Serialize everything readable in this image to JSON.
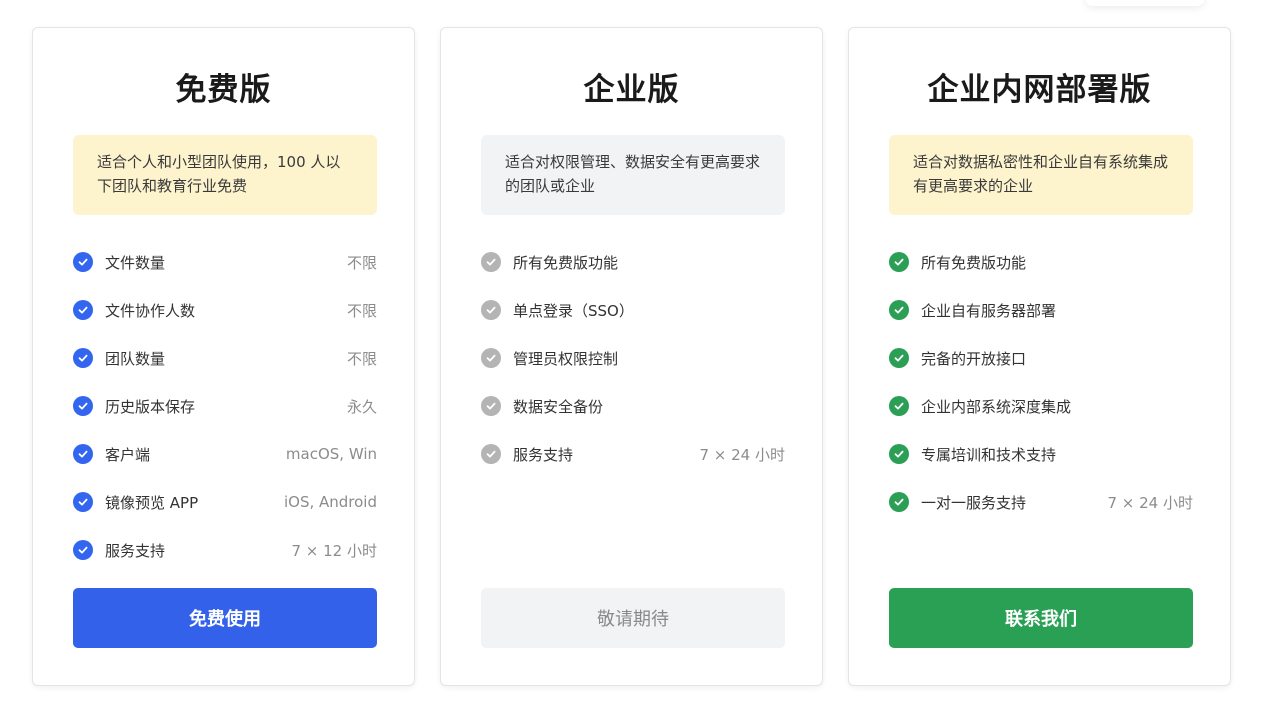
{
  "colors": {
    "blue_accent": "#3361ea",
    "green_accent": "#2aa055",
    "gray_check": "#b4b4b4",
    "yellow_box": "#fdf3cd",
    "gray_box": "#f2f3f5"
  },
  "plans": [
    {
      "title": "免费版",
      "description": "适合个人和小型团队使用，100 人以下团队和教育行业免费",
      "features": [
        {
          "label": "文件数量",
          "value": "不限"
        },
        {
          "label": "文件协作人数",
          "value": "不限"
        },
        {
          "label": "团队数量",
          "value": "不限"
        },
        {
          "label": "历史版本保存",
          "value": "永久"
        },
        {
          "label": "客户端",
          "value": "macOS, Win"
        },
        {
          "label": "镜像预览 APP",
          "value": "iOS, Android"
        },
        {
          "label": "服务支持",
          "value": "7 × 12 小时"
        }
      ],
      "button": "免费使用"
    },
    {
      "title": "企业版",
      "description": "适合对权限管理、数据安全有更高要求的团队或企业",
      "features": [
        {
          "label": "所有免费版功能",
          "value": ""
        },
        {
          "label": "单点登录（SSO）",
          "value": ""
        },
        {
          "label": "管理员权限控制",
          "value": ""
        },
        {
          "label": "数据安全备份",
          "value": ""
        },
        {
          "label": "服务支持",
          "value": "7 × 24 小时"
        }
      ],
      "button": "敬请期待"
    },
    {
      "title": "企业内网部署版",
      "description": "适合对数据私密性和企业自有系统集成有更高要求的企业",
      "features": [
        {
          "label": "所有免费版功能",
          "value": ""
        },
        {
          "label": "企业自有服务器部署",
          "value": ""
        },
        {
          "label": "完备的开放接口",
          "value": ""
        },
        {
          "label": "企业内部系统深度集成",
          "value": ""
        },
        {
          "label": "专属培训和技术支持",
          "value": ""
        },
        {
          "label": "一对一服务支持",
          "value": "7 × 24 小时"
        }
      ],
      "button": "联系我们"
    }
  ]
}
